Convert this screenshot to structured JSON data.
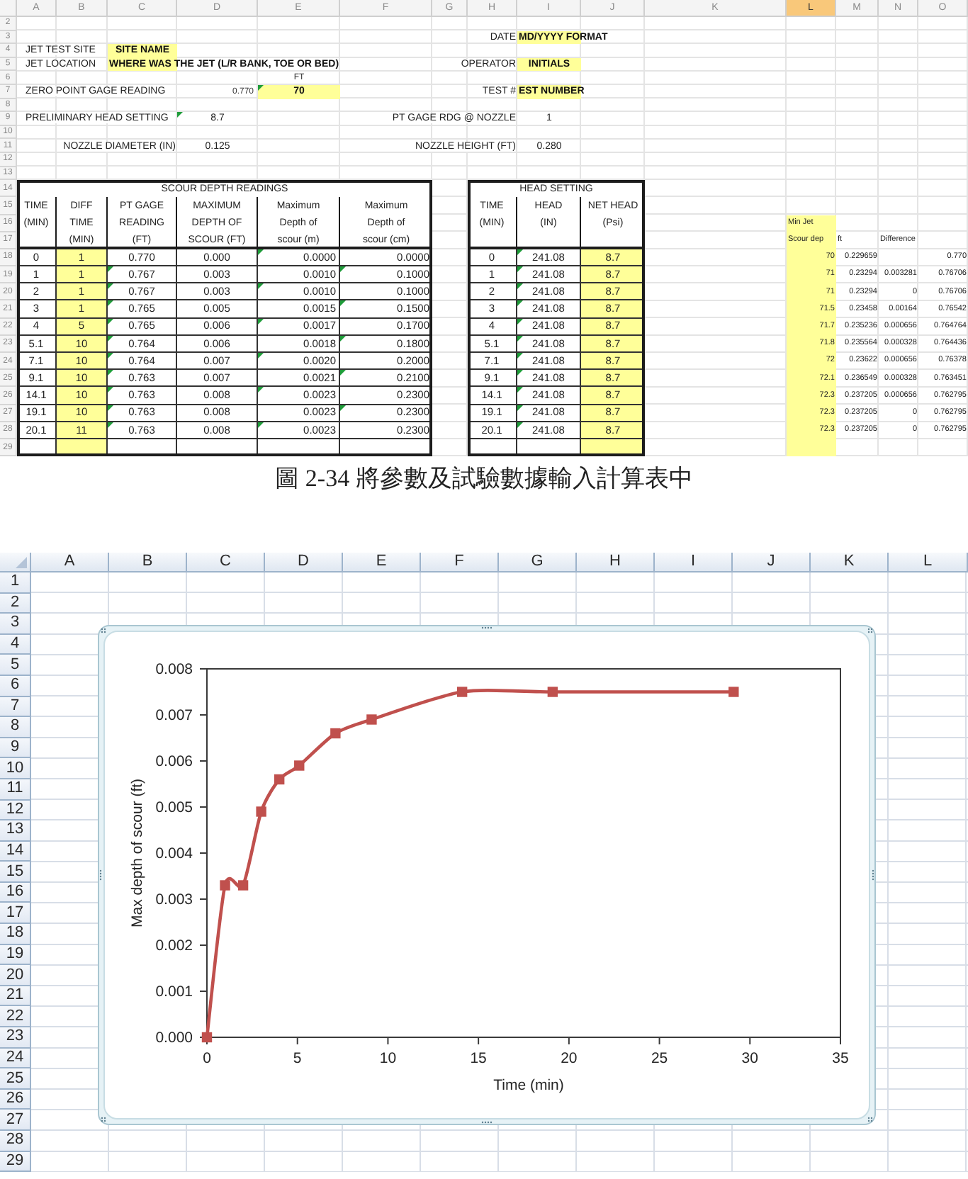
{
  "top_sheet": {
    "column_headers": [
      {
        "label": "A",
        "selected": false
      },
      {
        "label": "B",
        "selected": false
      },
      {
        "label": "C",
        "selected": false
      },
      {
        "label": "D",
        "selected": false
      },
      {
        "label": "E",
        "selected": false
      },
      {
        "label": "F",
        "selected": false
      },
      {
        "label": "G",
        "selected": false
      },
      {
        "label": "H",
        "selected": false
      },
      {
        "label": "I",
        "selected": false
      },
      {
        "label": "J",
        "selected": false
      },
      {
        "label": "K",
        "selected": false
      },
      {
        "label": "L",
        "selected": true
      },
      {
        "label": "M",
        "selected": false
      },
      {
        "label": "N",
        "selected": false
      },
      {
        "label": "O",
        "selected": false
      }
    ],
    "row_numbers": [
      "2",
      "3",
      "4",
      "5",
      "6",
      "7",
      "8",
      "9",
      "10",
      "11",
      "12",
      "13",
      "14",
      "15",
      "16",
      "17",
      "18",
      "19",
      "20",
      "21",
      "22",
      "23",
      "24",
      "25",
      "26",
      "27",
      "28",
      "29"
    ],
    "cells": [
      {
        "kind": "label",
        "text": "DATE",
        "flag": false
      },
      {
        "kind": "input",
        "text": "MD/YYYY FORMAT",
        "flag": false
      },
      {
        "kind": "label",
        "text": "JET TEST SITE",
        "flag": false
      },
      {
        "kind": "input",
        "text": "SITE NAME",
        "flag": false
      },
      {
        "kind": "label",
        "text": "JET LOCATION",
        "flag": false
      },
      {
        "kind": "input",
        "text": "WHERE WAS THE JET (L/R BANK, TOE OR BED)",
        "flag": false
      },
      {
        "kind": "label",
        "text": "OPERATOR",
        "flag": false
      },
      {
        "kind": "input",
        "text": "INITIALS",
        "flag": false
      },
      {
        "kind": "unit",
        "text": "FT",
        "flag": false
      },
      {
        "kind": "label",
        "text": "ZERO POINT GAGE READING",
        "flag": false
      },
      {
        "kind": "number",
        "text": "0.770",
        "flag": false
      },
      {
        "kind": "input",
        "text": "70",
        "flag": true
      },
      {
        "kind": "label",
        "text": "TEST #",
        "flag": false
      },
      {
        "kind": "input",
        "text": "EST NUMBER",
        "flag": false
      },
      {
        "kind": "label",
        "text": "PRELIMINARY HEAD SETTING",
        "flag": false
      },
      {
        "kind": "value",
        "text": "8.7",
        "flag": true
      },
      {
        "kind": "label",
        "text": "PT GAGE RDG @ NOZZLE",
        "flag": false
      },
      {
        "kind": "value",
        "text": "1",
        "flag": false
      },
      {
        "kind": "label",
        "text": "NOZZLE DIAMETER (IN)",
        "flag": false
      },
      {
        "kind": "value",
        "text": "0.125",
        "flag": false
      },
      {
        "kind": "label",
        "text": "NOZZLE HEIGHT (FT)",
        "flag": false
      },
      {
        "kind": "value",
        "text": "0.280",
        "flag": false
      }
    ],
    "scour_table": {
      "title": "SCOUR DEPTH READINGS",
      "columns": [
        {
          "lines": [
            "TIME",
            "(MIN)"
          ],
          "highlighted": false
        },
        {
          "lines": [
            "DIFF",
            "TIME",
            "(MIN)"
          ],
          "highlighted": true
        },
        {
          "lines": [
            "PT GAGE",
            "READING",
            "(FT)"
          ],
          "highlighted": false
        },
        {
          "lines": [
            "MAXIMUM",
            "DEPTH OF",
            "SCOUR (FT)"
          ],
          "highlighted": false
        },
        {
          "lines": [
            "Maximum",
            "Depth of",
            "scour (m)"
          ],
          "highlighted": false
        },
        {
          "lines": [
            "Maximum",
            "Depth of",
            "scour (cm)"
          ],
          "highlighted": false
        }
      ],
      "rows": [
        {
          "cells": [
            {
              "text": "0",
              "flag": false
            },
            {
              "text": "1",
              "flag": false
            },
            {
              "text": "0.770",
              "flag": false
            },
            {
              "text": "0.000",
              "flag": false
            },
            {
              "text": "0.0000",
              "flag": true
            },
            {
              "text": "0.0000",
              "flag": false
            }
          ]
        },
        {
          "cells": [
            {
              "text": "1",
              "flag": false
            },
            {
              "text": "1",
              "flag": false
            },
            {
              "text": "0.767",
              "flag": true
            },
            {
              "text": "0.003",
              "flag": false
            },
            {
              "text": "0.0010",
              "flag": false
            },
            {
              "text": "0.1000",
              "flag": true
            }
          ]
        },
        {
          "cells": [
            {
              "text": "2",
              "flag": false
            },
            {
              "text": "1",
              "flag": false
            },
            {
              "text": "0.767",
              "flag": true
            },
            {
              "text": "0.003",
              "flag": false
            },
            {
              "text": "0.0010",
              "flag": true
            },
            {
              "text": "0.1000",
              "flag": false
            }
          ]
        },
        {
          "cells": [
            {
              "text": "3",
              "flag": false
            },
            {
              "text": "1",
              "flag": false
            },
            {
              "text": "0.765",
              "flag": true
            },
            {
              "text": "0.005",
              "flag": false
            },
            {
              "text": "0.0015",
              "flag": false
            },
            {
              "text": "0.1500",
              "flag": true
            }
          ]
        },
        {
          "cells": [
            {
              "text": "4",
              "flag": false
            },
            {
              "text": "5",
              "flag": false
            },
            {
              "text": "0.765",
              "flag": true
            },
            {
              "text": "0.006",
              "flag": false
            },
            {
              "text": "0.0017",
              "flag": true
            },
            {
              "text": "0.1700",
              "flag": false
            }
          ]
        },
        {
          "cells": [
            {
              "text": "5.1",
              "flag": false
            },
            {
              "text": "10",
              "flag": false
            },
            {
              "text": "0.764",
              "flag": true
            },
            {
              "text": "0.006",
              "flag": false
            },
            {
              "text": "0.0018",
              "flag": false
            },
            {
              "text": "0.1800",
              "flag": true
            }
          ]
        },
        {
          "cells": [
            {
              "text": "7.1",
              "flag": false
            },
            {
              "text": "10",
              "flag": false
            },
            {
              "text": "0.764",
              "flag": true
            },
            {
              "text": "0.007",
              "flag": false
            },
            {
              "text": "0.0020",
              "flag": true
            },
            {
              "text": "0.2000",
              "flag": false
            }
          ]
        },
        {
          "cells": [
            {
              "text": "9.1",
              "flag": false
            },
            {
              "text": "10",
              "flag": false
            },
            {
              "text": "0.763",
              "flag": true
            },
            {
              "text": "0.007",
              "flag": false
            },
            {
              "text": "0.0021",
              "flag": false
            },
            {
              "text": "0.2100",
              "flag": true
            }
          ]
        },
        {
          "cells": [
            {
              "text": "14.1",
              "flag": false
            },
            {
              "text": "10",
              "flag": false
            },
            {
              "text": "0.763",
              "flag": true
            },
            {
              "text": "0.008",
              "flag": false
            },
            {
              "text": "0.0023",
              "flag": true
            },
            {
              "text": "0.2300",
              "flag": false
            }
          ]
        },
        {
          "cells": [
            {
              "text": "19.1",
              "flag": false
            },
            {
              "text": "10",
              "flag": false
            },
            {
              "text": "0.763",
              "flag": true
            },
            {
              "text": "0.008",
              "flag": false
            },
            {
              "text": "0.0023",
              "flag": false
            },
            {
              "text": "0.2300",
              "flag": true
            }
          ]
        },
        {
          "cells": [
            {
              "text": "20.1",
              "flag": false
            },
            {
              "text": "11",
              "flag": false
            },
            {
              "text": "0.763",
              "flag": true
            },
            {
              "text": "0.008",
              "flag": false
            },
            {
              "text": "0.0023",
              "flag": true
            },
            {
              "text": "0.2300",
              "flag": false
            }
          ]
        }
      ]
    },
    "head_table": {
      "title": "HEAD SETTING",
      "columns": [
        {
          "lines": [
            "TIME",
            "(MIN)"
          ],
          "highlighted": false
        },
        {
          "lines": [
            "HEAD",
            "(IN)"
          ],
          "highlighted": false
        },
        {
          "lines": [
            "NET HEAD",
            "(Psi)"
          ],
          "highlighted": true
        }
      ],
      "rows": [
        {
          "cells": [
            {
              "text": "0",
              "flag": false
            },
            {
              "text": "241.08",
              "flag": true
            },
            {
              "text": "8.7",
              "flag": false
            }
          ]
        },
        {
          "cells": [
            {
              "text": "1",
              "flag": false
            },
            {
              "text": "241.08",
              "flag": true
            },
            {
              "text": "8.7",
              "flag": false
            }
          ]
        },
        {
          "cells": [
            {
              "text": "2",
              "flag": false
            },
            {
              "text": "241.08",
              "flag": true
            },
            {
              "text": "8.7",
              "flag": false
            }
          ]
        },
        {
          "cells": [
            {
              "text": "3",
              "flag": false
            },
            {
              "text": "241.08",
              "flag": true
            },
            {
              "text": "8.7",
              "flag": false
            }
          ]
        },
        {
          "cells": [
            {
              "text": "4",
              "flag": false
            },
            {
              "text": "241.08",
              "flag": true
            },
            {
              "text": "8.7",
              "flag": false
            }
          ]
        },
        {
          "cells": [
            {
              "text": "5.1",
              "flag": false
            },
            {
              "text": "241.08",
              "flag": true
            },
            {
              "text": "8.7",
              "flag": false
            }
          ]
        },
        {
          "cells": [
            {
              "text": "7.1",
              "flag": false
            },
            {
              "text": "241.08",
              "flag": true
            },
            {
              "text": "8.7",
              "flag": false
            }
          ]
        },
        {
          "cells": [
            {
              "text": "9.1",
              "flag": false
            },
            {
              "text": "241.08",
              "flag": true
            },
            {
              "text": "8.7",
              "flag": false
            }
          ]
        },
        {
          "cells": [
            {
              "text": "14.1",
              "flag": false
            },
            {
              "text": "241.08",
              "flag": true
            },
            {
              "text": "8.7",
              "flag": false
            }
          ]
        },
        {
          "cells": [
            {
              "text": "19.1",
              "flag": false
            },
            {
              "text": "241.08",
              "flag": true
            },
            {
              "text": "8.7",
              "flag": false
            }
          ]
        },
        {
          "cells": [
            {
              "text": "20.1",
              "flag": false
            },
            {
              "text": "241.08",
              "flag": true
            },
            {
              "text": "8.7",
              "flag": false
            }
          ]
        }
      ]
    },
    "calc_block": {
      "highlighted": {
        "scour_depth": true,
        "depth_ft": false,
        "difference": false,
        "column_4": false
      },
      "header_rows": [
        {
          "scour_depth": "Min Jet"
        },
        {
          "scour_depth": "Scour dep",
          "depth_ft": "ft",
          "difference": "Difference"
        }
      ],
      "rows": [
        {
          "scour_depth": "70",
          "depth_ft": "0.229659",
          "column_4": "0.770"
        },
        {
          "scour_depth": "71",
          "depth_ft": "0.23294",
          "difference": "0.003281",
          "column_4": "0.76706"
        },
        {
          "scour_depth": "71",
          "depth_ft": "0.23294",
          "difference": "0",
          "column_4": "0.76706"
        },
        {
          "scour_depth": "71.5",
          "depth_ft": "0.23458",
          "difference": "0.00164",
          "column_4": "0.76542"
        },
        {
          "scour_depth": "71.7",
          "depth_ft": "0.235236",
          "difference": "0.000656",
          "column_4": "0.764764"
        },
        {
          "scour_depth": "71.8",
          "depth_ft": "0.235564",
          "difference": "0.000328",
          "column_4": "0.764436"
        },
        {
          "scour_depth": "72",
          "depth_ft": "0.23622",
          "difference": "0.000656",
          "column_4": "0.76378"
        },
        {
          "scour_depth": "72.1",
          "depth_ft": "0.236549",
          "difference": "0.000328",
          "column_4": "0.763451"
        },
        {
          "scour_depth": "72.3",
          "depth_ft": "0.237205",
          "difference": "0.000656",
          "column_4": "0.762795"
        },
        {
          "scour_depth": "72.3",
          "depth_ft": "0.237205",
          "difference": "0",
          "column_4": "0.762795"
        },
        {
          "scour_depth": "72.3",
          "depth_ft": "0.237205",
          "difference": "0",
          "column_4": "0.762795"
        }
      ]
    }
  },
  "caption": "圖 2-34 將參數及試驗數據輸入計算表中",
  "bottom_sheet": {
    "column_headers": [
      {
        "label": "A",
        "selected": false
      },
      {
        "label": "B",
        "selected": false
      },
      {
        "label": "C",
        "selected": false
      },
      {
        "label": "D",
        "selected": false
      },
      {
        "label": "E",
        "selected": false
      },
      {
        "label": "F",
        "selected": false
      },
      {
        "label": "G",
        "selected": false
      },
      {
        "label": "H",
        "selected": false
      },
      {
        "label": "I",
        "selected": false
      },
      {
        "label": "J",
        "selected": false
      },
      {
        "label": "K",
        "selected": false
      },
      {
        "label": "L",
        "selected": false
      }
    ],
    "row_numbers": [
      "1",
      "2",
      "3",
      "4",
      "5",
      "6",
      "7",
      "8",
      "9",
      "10",
      "11",
      "12",
      "13",
      "14",
      "15",
      "16",
      "17",
      "18",
      "19",
      "20",
      "21",
      "22",
      "23",
      "24",
      "25",
      "26",
      "27",
      "28",
      "29"
    ],
    "chart": {
      "chart_data": {
        "type": "line",
        "xlabel": "Time (min)",
        "ylabel": "Max depth of scour (ft)",
        "x": [
          0,
          1,
          2,
          3,
          4,
          5.1,
          7.1,
          9.1,
          14.1,
          19.1,
          29.1
        ],
        "series": [
          {
            "color": "#c0504d",
            "marker": "square",
            "values": [
              0,
              0.0033,
              0.0033,
              0.0049,
              0.0056,
              0.0059,
              0.0066,
              0.0069,
              0.0075,
              0.0075,
              0.0075
            ]
          }
        ],
        "xlim": [
          0,
          35
        ],
        "ylim": [
          0,
          0.008
        ],
        "xticks": [
          0,
          5,
          10,
          15,
          20,
          25,
          30,
          35
        ],
        "yticks": [
          {
            "value": 0,
            "label": "0.000"
          },
          {
            "value": 0.001,
            "label": "0.001"
          },
          {
            "value": 0.002,
            "label": "0.002"
          },
          {
            "value": 0.003,
            "label": "0.003"
          },
          {
            "value": 0.004,
            "label": "0.004"
          },
          {
            "value": 0.005,
            "label": "0.005"
          },
          {
            "value": 0.006,
            "label": "0.006"
          },
          {
            "value": 0.007,
            "label": "0.007"
          },
          {
            "value": 0.008,
            "label": "0.008"
          }
        ]
      }
    }
  }
}
